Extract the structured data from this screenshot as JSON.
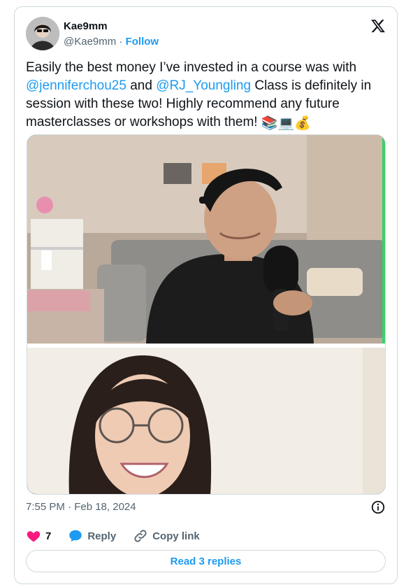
{
  "author": {
    "display_name": "Kae9mm",
    "handle": "@Kae9mm",
    "separator": "·",
    "follow_label": "Follow"
  },
  "tweet": {
    "line1": "Easily the best money I’ve invested in a course was with",
    "mention1": "@jenniferchou25",
    "and": " and ",
    "mention2": "@RJ_Youngling",
    "after_mentions": " Class is definitely in session with these two! Highly recommend any future masterclasses or workshops with them! ",
    "emojis": [
      "📚",
      "💻",
      "💰"
    ]
  },
  "timestamp": "7:55 PM · Feb 18, 2024",
  "actions": {
    "like_count": "7",
    "reply_label": "Reply",
    "copy_link_label": "Copy link"
  },
  "read_replies_label": "Read 3 replies",
  "colors": {
    "link_blue": "#1d9bf0",
    "heart_pink": "#f91880",
    "secondary_text": "#536471",
    "border": "#cfd9de"
  },
  "icons": [
    "x-logo-icon",
    "info-icon",
    "heart-icon",
    "reply-bubble-icon",
    "link-icon"
  ]
}
